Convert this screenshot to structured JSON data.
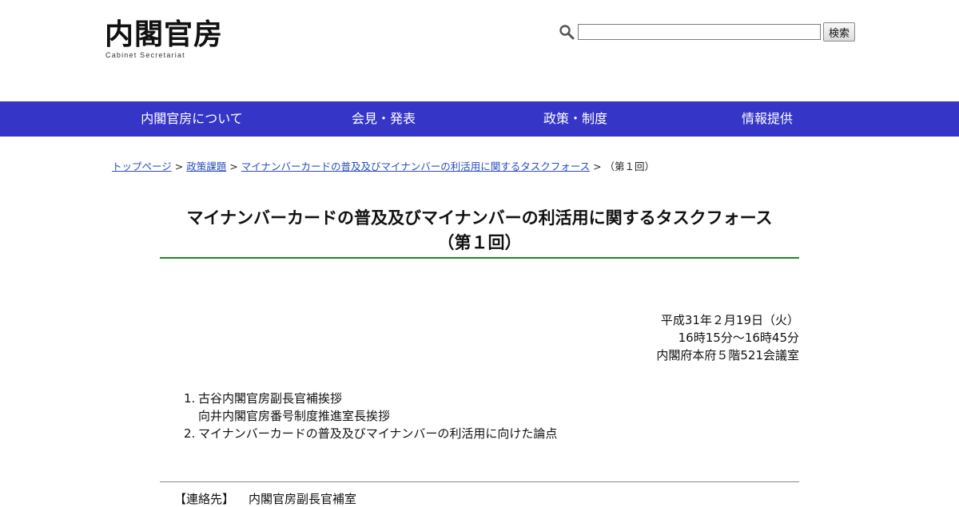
{
  "header": {
    "logo_main": "内閣官房",
    "logo_sub": "Cabinet Secretariat",
    "search_button": "検索",
    "search_value": ""
  },
  "nav": {
    "items": [
      "内閣官房について",
      "会見・発表",
      "政策・制度",
      "情報提供"
    ]
  },
  "breadcrumb": {
    "items": [
      "トップページ",
      "政策課題",
      "マイナンバーカードの普及及びマイナンバーの利活用に関するタスクフォース"
    ],
    "separator": ">",
    "current": "（第１回）"
  },
  "page": {
    "title_line1": "マイナンバーカードの普及及びマイナンバーの利活用に関するタスクフォース",
    "title_line2": "（第１回）",
    "date": "平成31年２月19日（火）",
    "time": "16時15分～16時45分",
    "place": "内閣府本府５階521会議室"
  },
  "agenda": [
    {
      "num": "1.",
      "lines": [
        "古谷内閣官房副長官補挨拶",
        "向井内閣官房番号制度推進室長挨拶"
      ]
    },
    {
      "num": "2.",
      "lines": [
        "マイナンバーカードの普及及びマイナンバーの利活用に向けた論点"
      ]
    }
  ],
  "contact": {
    "label": "【連絡先】",
    "value": "内閣官房副長官補室"
  },
  "colors": {
    "nav_bg": "#3535c8",
    "title_rule": "#1f8a1f",
    "link": "#2a4fbf"
  }
}
